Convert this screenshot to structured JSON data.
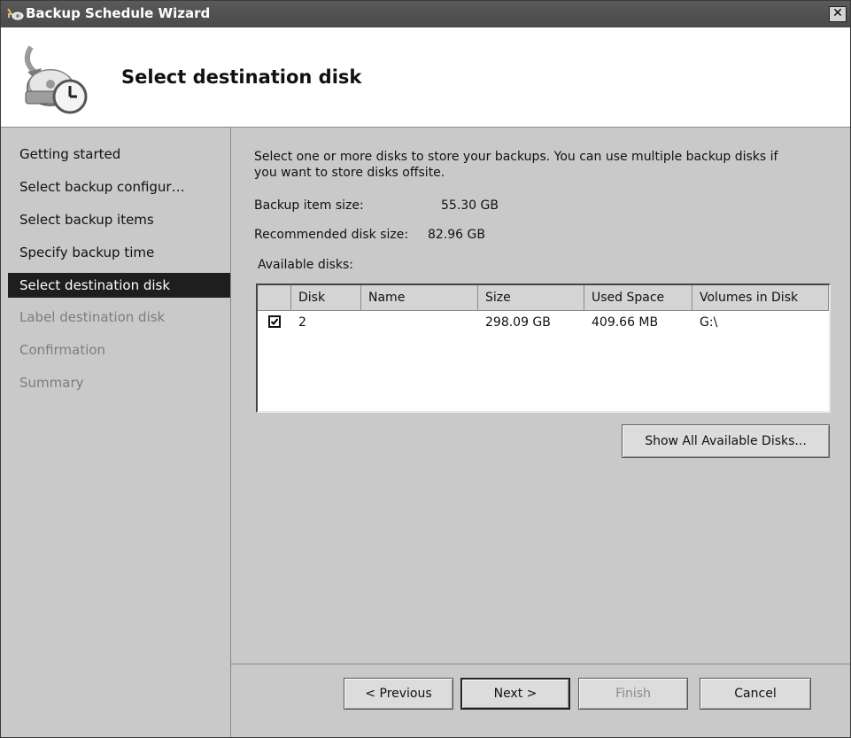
{
  "window": {
    "title": "Backup Schedule Wizard",
    "close_glyph": "✕"
  },
  "header": {
    "title": "Select destination disk",
    "icon": "backup-disk-clock-icon"
  },
  "sidebar": {
    "items": [
      {
        "label": "Getting started",
        "state": "done"
      },
      {
        "label": "Select backup configur…",
        "state": "done"
      },
      {
        "label": "Select backup items",
        "state": "done"
      },
      {
        "label": "Specify backup time",
        "state": "done"
      },
      {
        "label": "Select destination disk",
        "state": "active"
      },
      {
        "label": "Label destination disk",
        "state": "disabled"
      },
      {
        "label": "Confirmation",
        "state": "disabled"
      },
      {
        "label": "Summary",
        "state": "disabled"
      }
    ]
  },
  "main": {
    "description": "Select one or more disks to store your backups. You can use multiple backup disks if you want to store disks offsite.",
    "backup_item_size_label": "Backup item size:",
    "backup_item_size_value": "55.30 GB",
    "recommended_label": "Recommended disk size:",
    "recommended_value": "82.96 GB",
    "available_label": "Available disks:",
    "table": {
      "columns": [
        "Disk",
        "Name",
        "Size",
        "Used Space",
        "Volumes in Disk"
      ],
      "rows": [
        {
          "checked": true,
          "disk": "2",
          "name": "",
          "size": "298.09 GB",
          "used": "409.66 MB",
          "volumes": "G:\\"
        }
      ]
    },
    "show_all_button": "Show All Available Disks..."
  },
  "buttons": {
    "previous": "< Previous",
    "next": "Next >",
    "finish": "Finish",
    "cancel": "Cancel"
  }
}
